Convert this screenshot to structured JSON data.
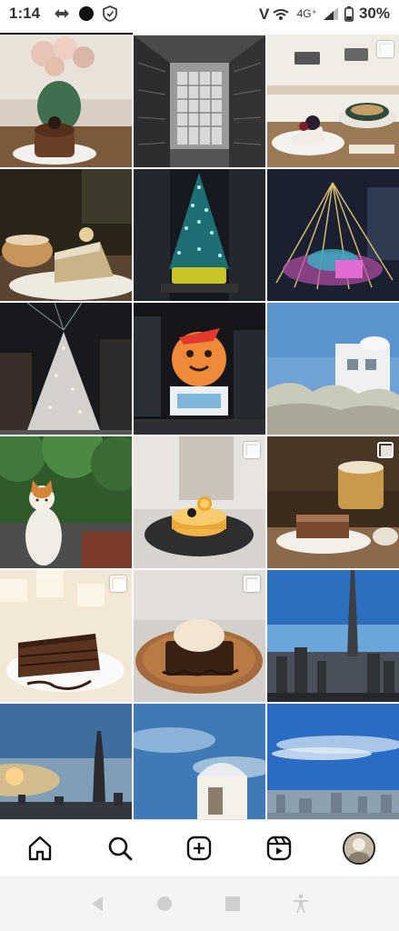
{
  "status_bar": {
    "time": "1:14",
    "network": "4G⁺",
    "battery": "30%"
  },
  "profile_grid": {
    "tiles": [
      {
        "subject": "cake-with-flowers",
        "multi": false
      },
      {
        "subject": "building-atrium-bw",
        "multi": false
      },
      {
        "subject": "cake-and-coffee",
        "multi": true
      },
      {
        "subject": "chiffon-cake-latte",
        "multi": false
      },
      {
        "subject": "christmas-tree-lights",
        "multi": false
      },
      {
        "subject": "light-tree-plaza",
        "multi": false
      },
      {
        "subject": "white-christmas-tree",
        "multi": false
      },
      {
        "subject": "gingerbread-balloon",
        "multi": false
      },
      {
        "subject": "white-house-grass",
        "multi": false
      },
      {
        "subject": "cat-on-wall",
        "multi": false
      },
      {
        "subject": "tart-on-plate",
        "multi": true
      },
      {
        "subject": "tiramisu-coffee",
        "multi": true
      },
      {
        "subject": "chocolate-cake-slice",
        "multi": true
      },
      {
        "subject": "brownie-ice-cream",
        "multi": true
      },
      {
        "subject": "taipei-101-blue-sky",
        "multi": false
      },
      {
        "subject": "taipei-101-sunrise",
        "multi": false
      },
      {
        "subject": "observatory-dome",
        "multi": false
      },
      {
        "subject": "city-skyline-clouds",
        "multi": false
      }
    ]
  },
  "bottom_nav": {
    "items": [
      "home-icon",
      "search-icon",
      "create-icon",
      "reels-icon",
      "profile-avatar"
    ]
  },
  "system_nav": {
    "items": [
      "back-icon",
      "home-circle-icon",
      "recents-icon",
      "accessibility-icon"
    ]
  }
}
